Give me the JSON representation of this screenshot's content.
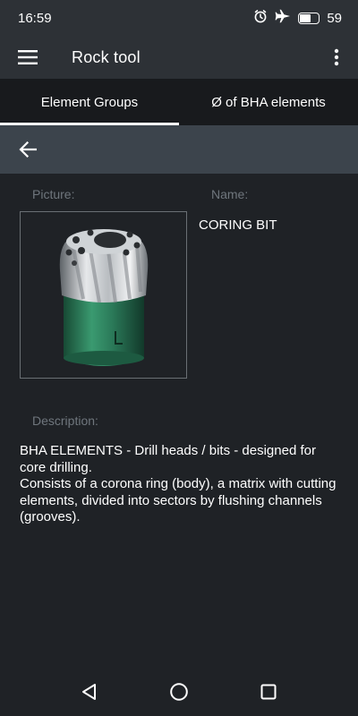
{
  "status_bar": {
    "time": "16:59",
    "battery_level": "59",
    "battery_fraction": 0.59,
    "icons": [
      "alarm-icon",
      "airplane-icon",
      "battery-icon"
    ]
  },
  "app_bar": {
    "title": "Rock tool",
    "menu_icon": "hamburger-menu-icon",
    "overflow_icon": "more-vert-icon"
  },
  "tabs": [
    {
      "label": "Element Groups",
      "active": true
    },
    {
      "label": "Ø of BHA elements",
      "active": false
    }
  ],
  "sub_bar": {
    "back_icon": "arrow-left-icon"
  },
  "detail": {
    "picture_label": "Picture:",
    "name_label": "Name:",
    "name_value": "CORING BIT",
    "image_subject": "coring-bit-image",
    "description_label": "Description:",
    "description_lines": [
      "BHA ELEMENTS - Drill heads / bits - designed for core drilling.",
      "Consists of a corona ring (body), a matrix with cutting elements, divided into sectors by flushing channels (grooves)."
    ]
  },
  "nav_bar": {
    "icons": [
      "back-triangle-icon",
      "home-circle-icon",
      "recents-square-icon"
    ]
  },
  "colors": {
    "background": "#1f2226",
    "app_bar": "#2d3136",
    "tabs_bg": "#181a1d",
    "sub_bar": "#3c444c",
    "label_gray": "#6f767d",
    "bit_green": "#2b7a59"
  }
}
